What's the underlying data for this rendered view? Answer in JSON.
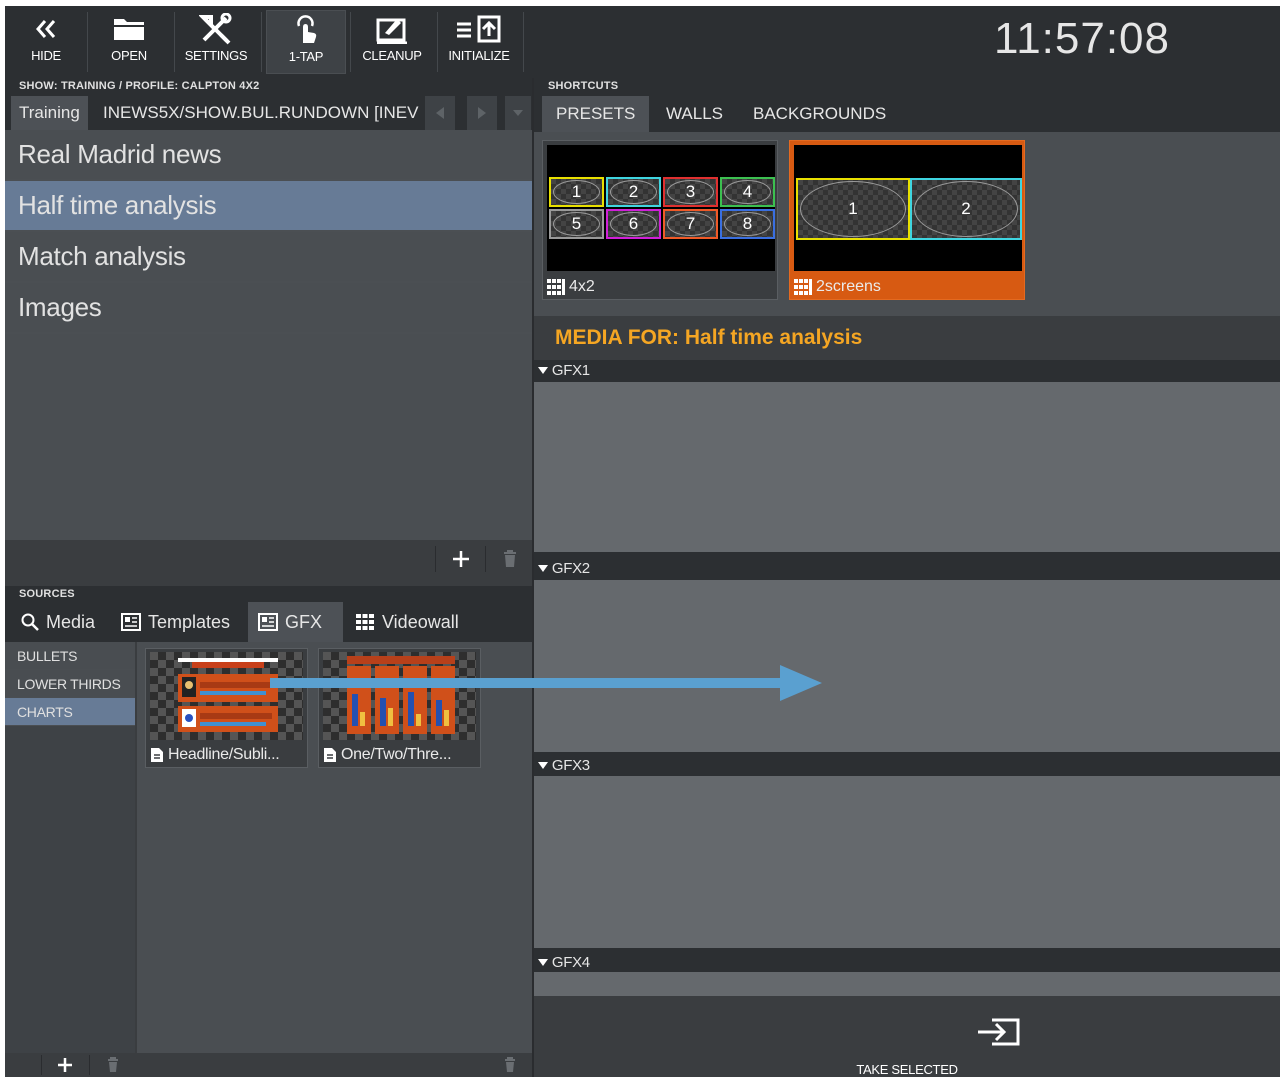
{
  "toolbar": {
    "buttons": [
      {
        "label": "HIDE",
        "icon": "double-chevron-left-icon"
      },
      {
        "label": "OPEN",
        "icon": "folder-icon"
      },
      {
        "label": "SETTINGS",
        "icon": "tools-icon"
      },
      {
        "label": "1-TAP",
        "icon": "tap-icon"
      },
      {
        "label": "CLEANUP",
        "icon": "cleanup-icon"
      },
      {
        "label": "INITIALIZE",
        "icon": "initialize-icon"
      }
    ],
    "active": "1-TAP",
    "clock": "11:57:08"
  },
  "show": {
    "header": "SHOW: TRAINING / PROFILE: CALPTON 4X2",
    "tabs": [
      "Training",
      "INEWS5X/SHOW.BUL.RUNDOWN [INEV"
    ],
    "playlist": [
      "Real Madrid news",
      "Half time analysis",
      "Match analysis",
      "Images"
    ],
    "selected": "Half time analysis"
  },
  "sources": {
    "header": "SOURCES",
    "tabs": [
      "Media",
      "Templates",
      "GFX",
      "Videowall"
    ],
    "selected_tab": "GFX",
    "categories": [
      "BULLETS",
      "LOWER THIRDS",
      "CHARTS"
    ],
    "selected_category": "CHARTS",
    "templates": [
      "Headline/Subli...",
      "One/Two/Thre..."
    ]
  },
  "shortcuts": {
    "header": "SHORTCUTS",
    "tabs": [
      "PRESETS",
      "WALLS",
      "BACKGROUNDS"
    ],
    "selected_tab": "PRESETS",
    "presets": [
      {
        "name": "4x2",
        "cells": [
          "1",
          "2",
          "3",
          "4",
          "5",
          "6",
          "7",
          "8"
        ]
      },
      {
        "name": "2screens",
        "cells": [
          "1",
          "2"
        ]
      }
    ],
    "selected_preset": "2screens"
  },
  "media": {
    "label": "MEDIA FOR:",
    "value": "Half time analysis",
    "groups": [
      "GFX1",
      "GFX2",
      "GFX3",
      "GFX4"
    ]
  },
  "take": {
    "label": "TAKE SELECTED"
  },
  "colors": {
    "accent_orange": "#d75a12",
    "selection_blue": "#677b96",
    "media_label": "#f5a623",
    "cell_yellow": "#e8e000",
    "cell_cyan": "#3fd5e0",
    "cell_red": "#e03030",
    "cell_green": "#3cc050",
    "cell_gray": "#9a9a9a",
    "cell_magenta": "#d020d8",
    "cell_orange": "#f05a28",
    "cell_blue": "#3a6fe0",
    "arrow_blue": "#5aa0d0"
  }
}
